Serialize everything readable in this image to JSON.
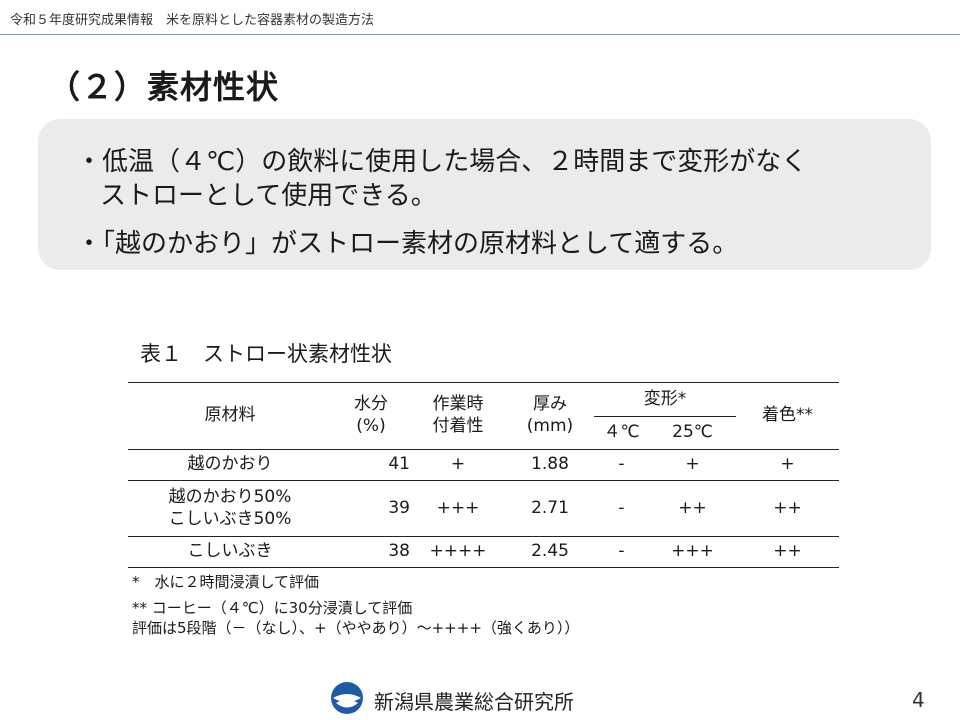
{
  "header": {
    "title": "令和５年度研究成果情報　米を原料とした容器素材の製造方法"
  },
  "section": {
    "heading": "（２）素材性状"
  },
  "summary": {
    "bullet1_line1": "・低温（４℃）の飲料に使用した場合、２時間まで変形がなく",
    "bullet1_line2": "ストローとして使用できる。",
    "bullet2": "・「越のかおり」がストロー素材の原材料として適する。"
  },
  "table": {
    "caption": "表１　ストロー状素材性状",
    "headers": {
      "material": "原材料",
      "moisture_line1": "水分",
      "moisture_line2": "(%)",
      "adhesion_line1": "作業時",
      "adhesion_line2": "付着性",
      "thickness_line1": "厚み",
      "thickness_line2": "(mm)",
      "deformation": "変形*",
      "deform_4c": "４℃",
      "deform_25c": "25℃",
      "coloring": "着色**"
    },
    "rows": [
      {
        "material": "越のかおり",
        "moisture": "41",
        "adhesion": "+",
        "thickness": "1.88",
        "deform_4c": "-",
        "deform_25c": "+",
        "coloring": "+"
      },
      {
        "material_line1": "越のかおり50%",
        "material_line2": "こしいぶき50%",
        "moisture": "39",
        "adhesion": "+++",
        "thickness": "2.71",
        "deform_4c": "-",
        "deform_25c": "++",
        "coloring": "++"
      },
      {
        "material": "こしいぶき",
        "moisture": "38",
        "adhesion": "++++",
        "thickness": "2.45",
        "deform_4c": "-",
        "deform_25c": "+++",
        "coloring": "++"
      }
    ]
  },
  "footnotes": {
    "note1": "*　水に２時間浸漬して評価",
    "note2": "** コーヒー（４℃）に30分浸漬して評価",
    "note3": "評価は5段階（－（なし）、+（ややあり）～++++（強くあり））"
  },
  "footer": {
    "organization": "新潟県農業総合研究所",
    "logo_icon": "institute-logo-icon",
    "logo_color": "#1f5aa6",
    "page_number": "4"
  }
}
